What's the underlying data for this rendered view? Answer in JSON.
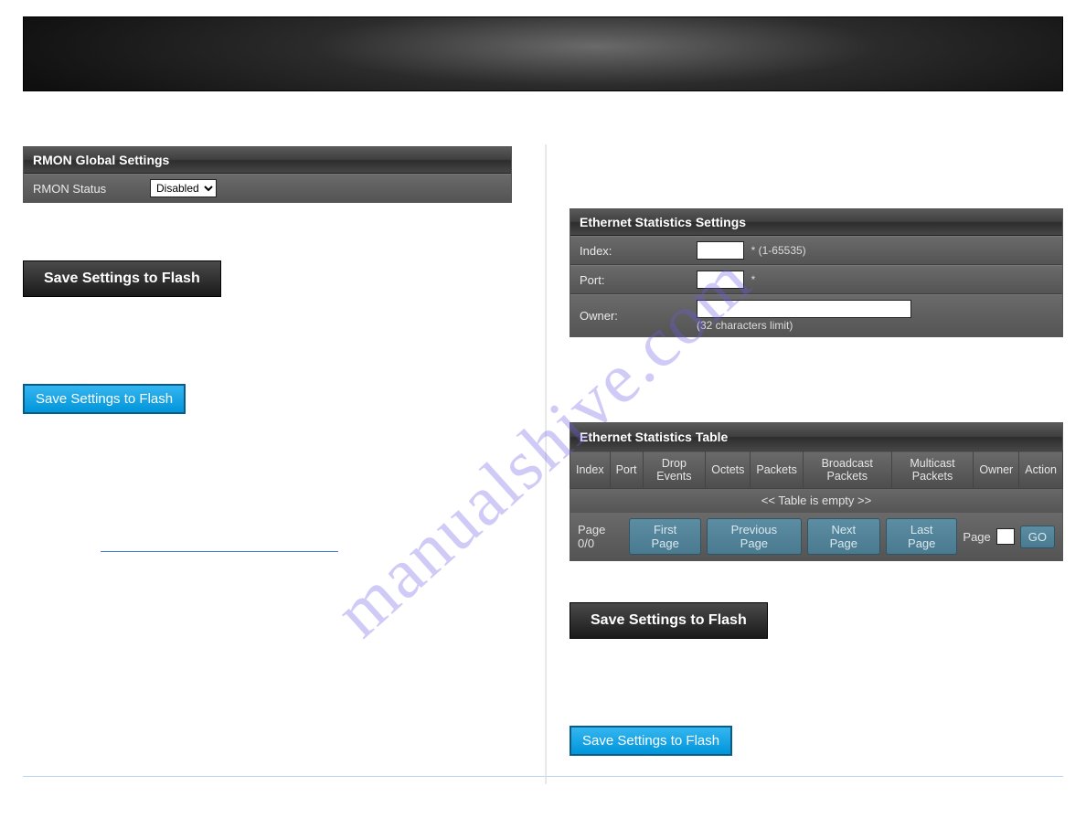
{
  "watermark": "manualshive.com",
  "left": {
    "panel1": {
      "title": "RMON Global Settings",
      "status_label": "RMON Status",
      "status_value": "Disabled"
    },
    "save_dark": "Save Settings to Flash",
    "save_blue": "Save Settings to Flash"
  },
  "right": {
    "settings": {
      "title": "Ethernet Statistics Settings",
      "index_label": "Index:",
      "index_hint": "* (1-65535)",
      "port_label": "Port:",
      "port_hint": "*",
      "owner_label": "Owner:",
      "owner_hint": "(32 characters limit)"
    },
    "table": {
      "title": "Ethernet Statistics Table",
      "cols": {
        "c0": "Index",
        "c1": "Port",
        "c2": "Drop Events",
        "c3": "Octets",
        "c4": "Packets",
        "c5": "Broadcast Packets",
        "c6": "Multicast Packets",
        "c7": "Owner",
        "c8": "Action"
      },
      "empty": "<< Table is empty >>",
      "pager": {
        "page_prefix": "Page 0/0",
        "first": "First Page",
        "prev": "Previous Page",
        "next": "Next Page",
        "last": "Last Page",
        "page_label": "Page",
        "go": "GO"
      }
    },
    "save_dark": "Save Settings to Flash",
    "save_blue": "Save Settings to Flash"
  }
}
